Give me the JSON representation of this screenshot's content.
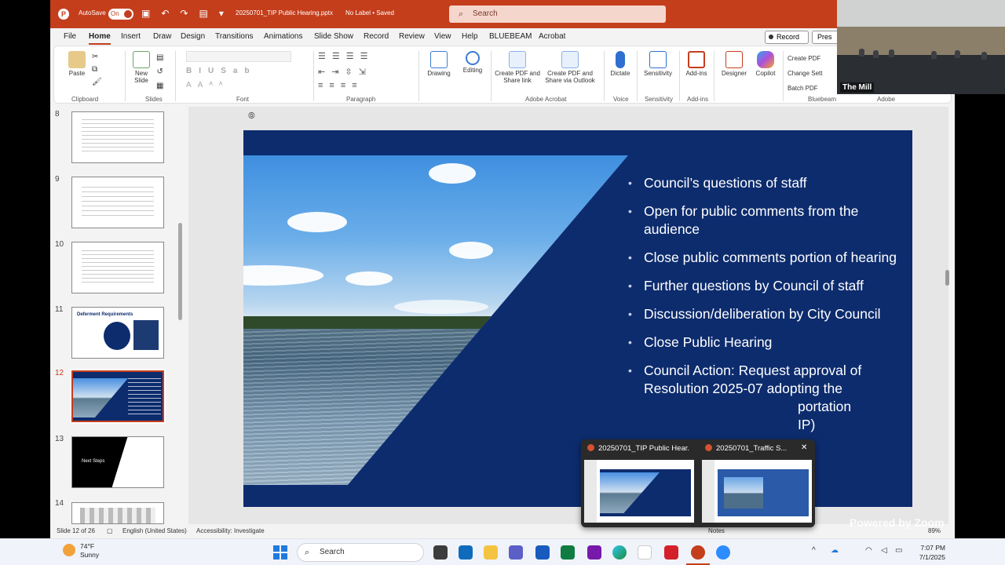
{
  "titlebar": {
    "autosave_label": "AutoSave",
    "autosave_state": "On",
    "filename": "20250701_TIP Public Hearing.pptx",
    "label_status": "No Label • Saved",
    "search_placeholder": "Search"
  },
  "menu": [
    "File",
    "Home",
    "Insert",
    "Draw",
    "Design",
    "Transitions",
    "Animations",
    "Slide Show",
    "Record",
    "Review",
    "View",
    "Help",
    "BLUEBEAM",
    "Acrobat"
  ],
  "menu_active": "Home",
  "record_label": "Record",
  "present_label": "Pres",
  "ribbon": {
    "paste": "Paste",
    "new_slide": "New Slide",
    "drawing": "Drawing",
    "editing": "Editing",
    "create_pdf_share": "Create PDF and Share link",
    "create_pdf_outlook": "Create PDF and Share via Outlook",
    "dictate": "Dictate",
    "sensitivity": "Sensitivity",
    "addins": "Add-ins",
    "designer": "Designer",
    "copilot": "Copilot",
    "bb_create": "Create PDF",
    "bb_change": "Change Sett",
    "bb_batch": "Batch PDF",
    "groups": {
      "clipboard": "Clipboard",
      "slides": "Slides",
      "font": "Font",
      "paragraph": "Paragraph",
      "adobe": "Adobe Acrobat",
      "voice": "Voice",
      "sensitivity": "Sensitivity",
      "addins": "Add-ins",
      "bluebeam": "Bluebeam",
      "adobe2": "Adobe"
    }
  },
  "thumbnails": [
    {
      "num": "8"
    },
    {
      "num": "9"
    },
    {
      "num": "10"
    },
    {
      "num": "11",
      "title": "Deferment Requirements"
    },
    {
      "num": "12"
    },
    {
      "num": "13",
      "title": "Next Steps"
    },
    {
      "num": "14"
    }
  ],
  "slide": {
    "bullets": [
      "Council’s questions of staff",
      "Open for public comments from the audience",
      "Close public comments portion of hearing",
      "Further questions by Council of staff",
      "Discussion/deliberation by City Council",
      "Close Public Hearing",
      "Council Action: Request approval of Resolution 2025-07 adopting the",
      "portation",
      "IP)"
    ]
  },
  "status": {
    "slide_counter": "Slide 12 of 26",
    "language": "English (United States)",
    "accessibility": "Accessibility: Investigate",
    "notes": "Notes",
    "zoom": "89%"
  },
  "zoom_video": {
    "name": "The Mill"
  },
  "popup": {
    "win1": "20250701_TIP Public Hear...",
    "win2": "20250701_Traffic S...",
    "close": "✕"
  },
  "powered": "Powered by Zoom",
  "taskbar": {
    "temp": "74°F",
    "condition": "Sunny",
    "search": "Search",
    "time": "7:07 PM",
    "date": "7/1/2025"
  }
}
